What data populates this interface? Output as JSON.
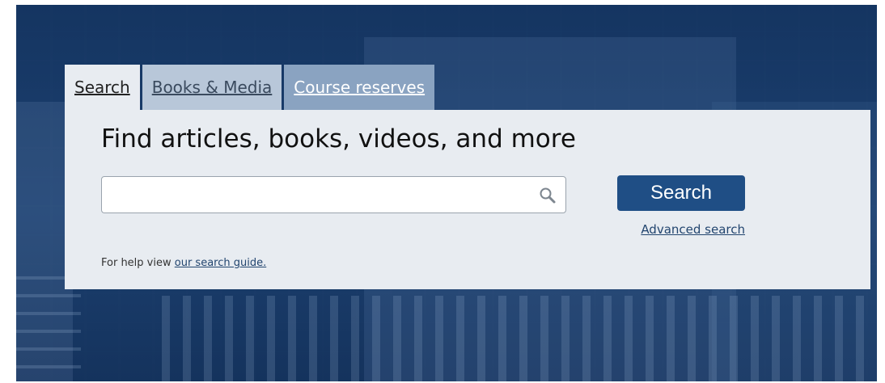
{
  "tabs": [
    {
      "label": "Search",
      "active": true
    },
    {
      "label": "Books & Media",
      "active": false
    },
    {
      "label": "Course reserves",
      "active": false
    }
  ],
  "panel": {
    "heading": "Find articles, books, videos, and more",
    "search_input_value": "",
    "search_button_label": "Search",
    "advanced_search_label": "Advanced search",
    "help_prefix": "For help view ",
    "help_link_label": "our search guide."
  },
  "icons": {
    "search_field_icon": "search-icon"
  },
  "colors": {
    "hero_background": "#1b3f6e",
    "panel_background": "#e8ecf1",
    "button_blue": "#1f4e85",
    "link_blue": "#22456f",
    "tab_active": "#e8ecf1",
    "tab_mid": "#b8c7d9",
    "tab_last": "#8aa3c1"
  }
}
